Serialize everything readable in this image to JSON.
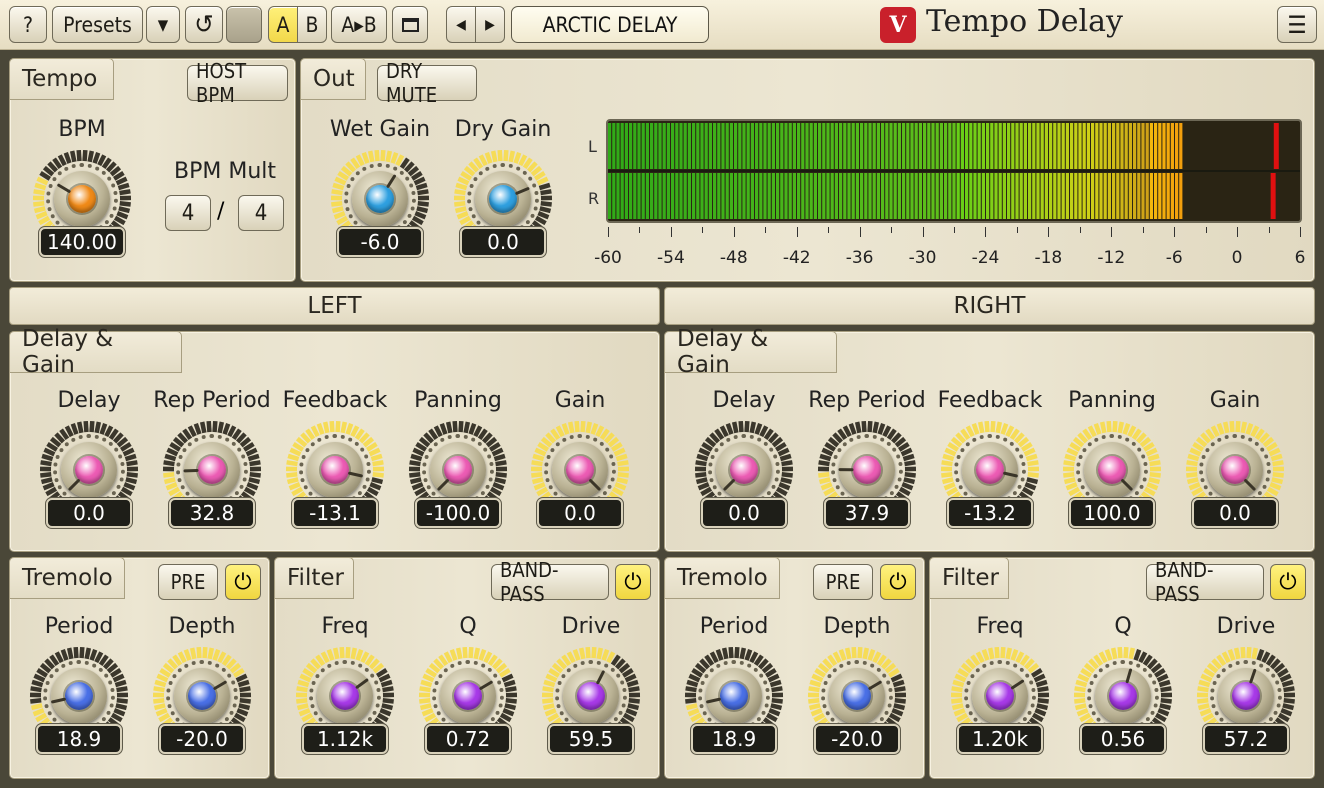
{
  "toolbar": {
    "help_label": "?",
    "presets_label": "Presets",
    "dropdown_icon": "triangle-down-icon",
    "reset_icon": "reset-icon",
    "a_label": "A",
    "b_label": "B",
    "ab_label": "A▸B",
    "window_icon": "window-icon",
    "prev_icon": "arrow-left-icon",
    "next_icon": "arrow-right-icon",
    "preset_name": "ARCTIC DELAY",
    "app_name": "Tempo Delay",
    "menu_icon": "hamburger-icon"
  },
  "tempo": {
    "tab": "Tempo",
    "host_bpm": "HOST BPM",
    "bpm_label": "BPM",
    "bpm_value": "140.00",
    "mult_label": "BPM Mult",
    "mult_num": "4",
    "mult_sep": "/",
    "mult_den": "4"
  },
  "out": {
    "tab": "Out",
    "dry_mute": "DRY MUTE",
    "wet_label": "Wet Gain",
    "wet_value": "-6.0",
    "dry_label": "Dry Gain",
    "dry_value": "0.0",
    "meter": {
      "channel_l": "L",
      "channel_r": "R",
      "scale": [
        "-60",
        "-54",
        "-48",
        "-42",
        "-36",
        "-30",
        "-24",
        "-18",
        "-12",
        "-6",
        "0",
        "6"
      ],
      "level_db": -5.5,
      "peak_l_db": 3.5,
      "peak_r_db": 3.2
    }
  },
  "left": {
    "header": "LEFT",
    "dg_tab": "Delay & Gain",
    "delay": {
      "label": "Delay",
      "value": "0.0"
    },
    "rep": {
      "label": "Rep Period",
      "value": "32.8"
    },
    "feedback": {
      "label": "Feedback",
      "value": "-13.1"
    },
    "panning": {
      "label": "Panning",
      "value": "-100.0"
    },
    "gain": {
      "label": "Gain",
      "value": "0.0"
    },
    "trem_tab": "Tremolo",
    "trem_pre": "PRE",
    "period": {
      "label": "Period",
      "value": "18.9"
    },
    "depth": {
      "label": "Depth",
      "value": "-20.0"
    },
    "filt_tab": "Filter",
    "filt_type": "BAND-PASS",
    "freq": {
      "label": "Freq",
      "value": "1.12k"
    },
    "q": {
      "label": "Q",
      "value": "0.72"
    },
    "drive": {
      "label": "Drive",
      "value": "59.5"
    }
  },
  "right": {
    "header": "RIGHT",
    "dg_tab": "Delay & Gain",
    "delay": {
      "label": "Delay",
      "value": "0.0"
    },
    "rep": {
      "label": "Rep Period",
      "value": "37.9"
    },
    "feedback": {
      "label": "Feedback",
      "value": "-13.2"
    },
    "panning": {
      "label": "Panning",
      "value": "100.0"
    },
    "gain": {
      "label": "Gain",
      "value": "0.0"
    },
    "trem_tab": "Tremolo",
    "trem_pre": "PRE",
    "period": {
      "label": "Period",
      "value": "18.9"
    },
    "depth": {
      "label": "Depth",
      "value": "-20.0"
    },
    "filt_tab": "Filter",
    "filt_type": "BAND-PASS",
    "freq": {
      "label": "Freq",
      "value": "1.20k"
    },
    "q": {
      "label": "Q",
      "value": "0.56"
    },
    "drive": {
      "label": "Drive",
      "value": "57.2"
    }
  },
  "colors": {
    "orange": "#f08a18",
    "blue": "#2fa0e0",
    "pink": "#ec5cb4",
    "periwinkle": "#4a70e6",
    "violet": "#a83ae8",
    "yellow_arc": "#f6dc57",
    "dark_arc": "#3b372c"
  },
  "knob_levels": {
    "bpm": 0.28,
    "wet": 0.62,
    "dry": 0.75,
    "l_delay": 0.0,
    "l_rep": 0.16,
    "l_feedback": 0.88,
    "l_panning": 0.0,
    "l_gain": 1.0,
    "r_delay": 0.0,
    "r_rep": 0.17,
    "r_feedback": 0.88,
    "r_panning": 1.0,
    "r_gain": 1.0,
    "l_period": 0.12,
    "l_depth": 0.72,
    "l_freq": 0.7,
    "l_q": 0.72,
    "l_drive": 0.6,
    "r_period": 0.12,
    "r_depth": 0.72,
    "r_freq": 0.71,
    "r_q": 0.56,
    "r_drive": 0.57
  }
}
